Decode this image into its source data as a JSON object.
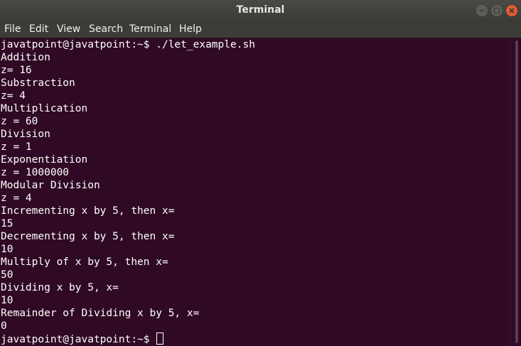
{
  "window": {
    "title": "Terminal"
  },
  "menu": {
    "items": [
      "File",
      "Edit",
      "View",
      "Search",
      "Terminal",
      "Help"
    ]
  },
  "terminal": {
    "lines": [
      "javatpoint@javatpoint:~$ ./let_example.sh",
      "Addition",
      "z= 16",
      "Substraction",
      "z= 4",
      "Multiplication",
      "z = 60",
      "Division",
      "z = 1",
      "Exponentiation",
      "z = 1000000",
      "Modular Division",
      "z = 4",
      "Incrementing x by 5, then x=",
      "15",
      "Decrementing x by 5, then x=",
      "10",
      "Multiply of x by 5, then x=",
      "50",
      "Dividing x by 5, x=",
      "10",
      "Remainder of Dividing x by 5, x=",
      "0"
    ],
    "prompt": "javatpoint@javatpoint:~$ "
  },
  "colors": {
    "terminal_background": "#300a24",
    "titlebar_background": "#3c3b37",
    "text": "#ffffff",
    "close_button": "#e05b31"
  }
}
